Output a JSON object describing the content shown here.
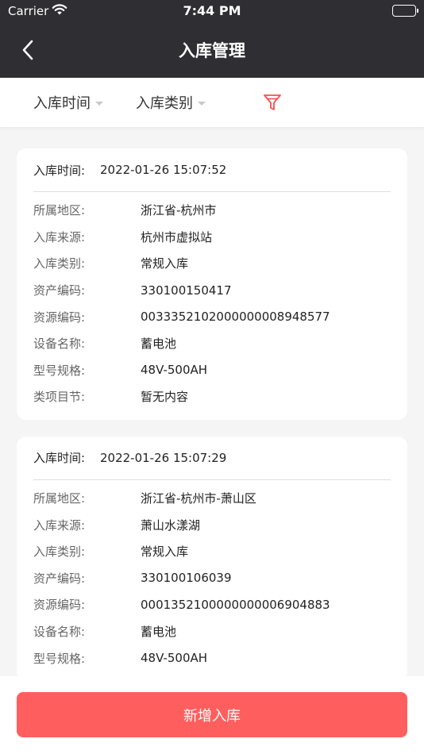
{
  "status_bar": {
    "carrier": "Carrier",
    "time": "7:44 PM"
  },
  "nav": {
    "title": "入库管理"
  },
  "filters": {
    "time_label": "入库时间",
    "category_label": "入库类别"
  },
  "records": [
    {
      "head_label": "入库时间:",
      "time": "2022-01-26 15:07:52",
      "fields": [
        {
          "k": "所属地区:",
          "v": "浙江省-杭州市"
        },
        {
          "k": "入库来源:",
          "v": "杭州市虚拟站"
        },
        {
          "k": "入库类别:",
          "v": "常规入库"
        },
        {
          "k": "资产编码:",
          "v": "330100150417"
        },
        {
          "k": "资源编码:",
          "v": "0033352102000000008948577"
        },
        {
          "k": "设备名称:",
          "v": "蓄电池"
        },
        {
          "k": "型号规格:",
          "v": "48V-500AH"
        },
        {
          "k": "类项目节:",
          "v": "暂无内容"
        }
      ]
    },
    {
      "head_label": "入库时间:",
      "time": "2022-01-26 15:07:29",
      "fields": [
        {
          "k": "所属地区:",
          "v": "浙江省-杭州市-萧山区"
        },
        {
          "k": "入库来源:",
          "v": "萧山水漾湖"
        },
        {
          "k": "入库类别:",
          "v": "常规入库"
        },
        {
          "k": "资产编码:",
          "v": "330100106039"
        },
        {
          "k": "资源编码:",
          "v": "0001352100000000006904883"
        },
        {
          "k": "设备名称:",
          "v": "蓄电池"
        },
        {
          "k": "型号规格:",
          "v": "48V-500AH"
        }
      ]
    }
  ],
  "bottom": {
    "add_label": "新增入库"
  },
  "colors": {
    "nav_bg": "#2f2e33",
    "accent": "#ff5e5e",
    "filter_icon": "#ff4d4d"
  }
}
